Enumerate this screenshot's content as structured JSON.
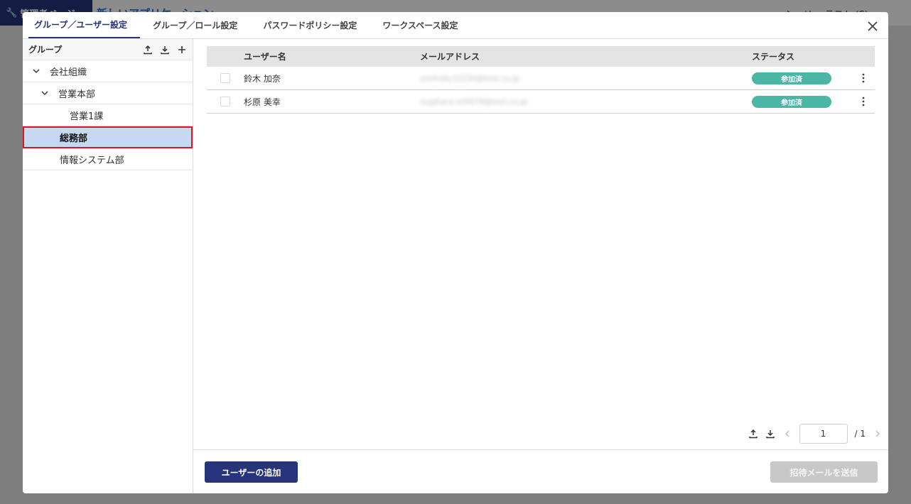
{
  "background": {
    "badge_label": "管理者ページ",
    "app_name": "新しいアプリケーション",
    "user_label": "シャリー テスト (S)"
  },
  "tabs": [
    {
      "label": "グループ／ユーザー設定",
      "active": true
    },
    {
      "label": "グループ／ロール設定",
      "active": false
    },
    {
      "label": "パスワードポリシー設定",
      "active": false
    },
    {
      "label": "ワークスペース設定",
      "active": false
    }
  ],
  "left_panel": {
    "title": "グループ",
    "tree": [
      {
        "label": "会社組織",
        "expanded": true,
        "level": 0
      },
      {
        "label": "営業本部",
        "expanded": true,
        "level": 1
      },
      {
        "label": "営業1課",
        "level": 2
      },
      {
        "label": "総務部",
        "level": 1,
        "selected": true
      },
      {
        "label": "情報システム部",
        "level": 1
      }
    ]
  },
  "table": {
    "headers": {
      "name": "ユーザー名",
      "email": "メールアドレス",
      "status": "ステータス"
    },
    "rows": [
      {
        "name": "鈴木 加奈",
        "email": "yoshida.t1234@test.co.jp",
        "status": "参加済"
      },
      {
        "name": "杉原 美幸",
        "email": "sugihara.m5678@test.co.jp",
        "status": "参加済"
      }
    ]
  },
  "pager": {
    "current_page": "1",
    "total_label": "/ 1"
  },
  "footer": {
    "add_user_label": "ユーザーの追加",
    "send_invite_label": "招待メールを送信"
  },
  "colors": {
    "primary": "#27337a",
    "status_joined": "#4bb5a6",
    "selected_row": "#c9d8f2",
    "highlight_border": "#e0141e",
    "disabled_button": "#c8c8c8"
  }
}
